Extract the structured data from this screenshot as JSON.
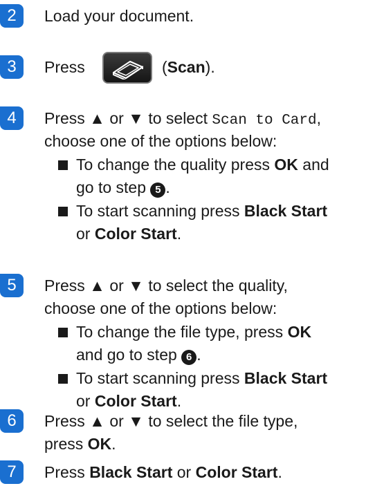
{
  "steps": [
    {
      "number": "2",
      "text": "Load your document."
    },
    {
      "number": "3",
      "press": "Press",
      "paren_open": "(",
      "scan": "Scan",
      "paren_close": ")."
    },
    {
      "number": "4",
      "l1_a": "Press ▲ or ▼ to select ",
      "l1_code": "Scan to Card",
      "l1_b": ",",
      "l2": "choose one of the options below:",
      "b1_l1_a": "To change the quality press ",
      "b1_l1_ok": "OK",
      "b1_l1_b": " and",
      "b1_l2_a": "go to step ",
      "b1_ref": "5",
      "b1_l2_b": ".",
      "b2_l1_a": "To start scanning press ",
      "b2_l1_bs": "Black Start",
      "b2_l2_a": "or ",
      "b2_l2_cs": "Color Start",
      "b2_l2_b": "."
    },
    {
      "number": "5",
      "l1": "Press ▲ or ▼ to select the quality,",
      "l2": "choose one of the options below:",
      "b1_l1_a": "To change the file type, press ",
      "b1_l1_ok": "OK",
      "b1_l2_a": "and go to step ",
      "b1_ref": "6",
      "b1_l2_b": ".",
      "b2_l1_a": "To start scanning press ",
      "b2_l1_bs": "Black Start",
      "b2_l2_a": "or ",
      "b2_l2_cs": "Color Start",
      "b2_l2_b": "."
    },
    {
      "number": "6",
      "l1": "Press ▲ or ▼ to select the file type,",
      "l2_a": "press ",
      "l2_ok": "OK",
      "l2_b": "."
    },
    {
      "number": "7",
      "a": "Press ",
      "bs": "Black Start",
      "or": " or ",
      "cs": "Color Start",
      "b": "."
    }
  ],
  "colors": {
    "step_badge": "#1a6fd0",
    "text": "#1a1a1a"
  },
  "icons": {
    "scan_button": "scan-key-icon",
    "bullet": "black-square-bullet"
  }
}
